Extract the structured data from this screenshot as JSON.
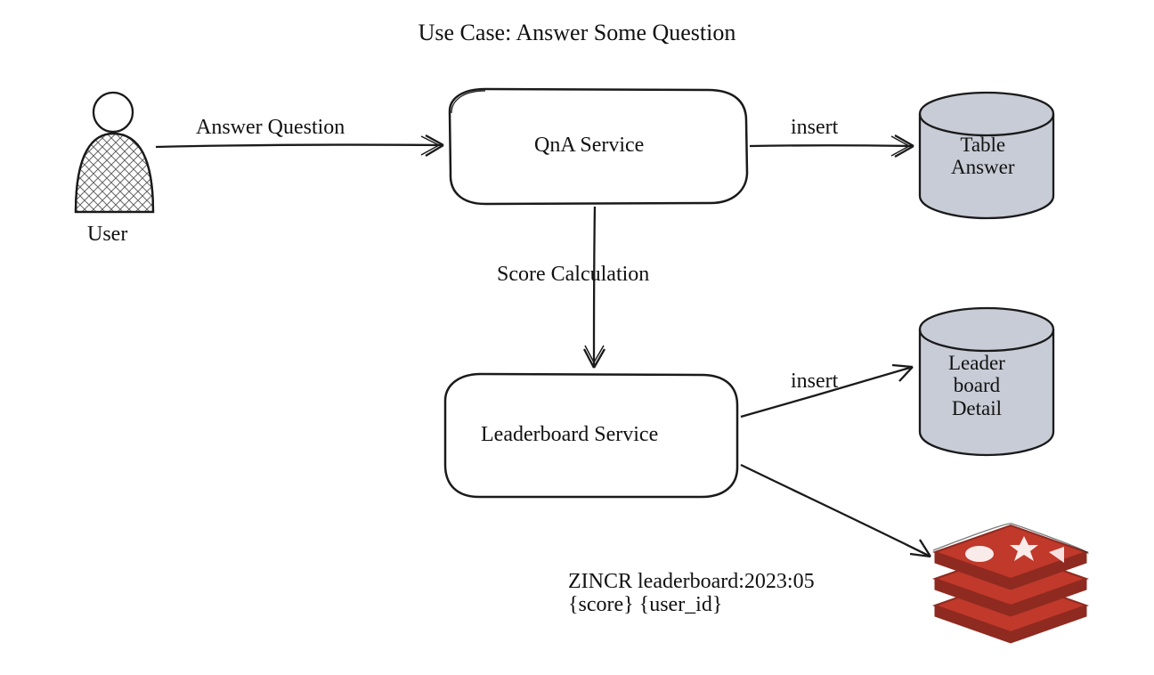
{
  "title": "Use Case: Answer Some Question",
  "actors": {
    "user": "User"
  },
  "nodes": {
    "qna_service": "QnA Service",
    "leaderboard_service": "Leaderboard Service",
    "table_answer": "Table\nAnswer",
    "leaderboard_detail": "Leader\nboard\nDetail"
  },
  "edges": {
    "answer_question": "Answer Question",
    "insert_answer": "insert",
    "score_calculation": "Score Calculation",
    "insert_leaderboard": "insert"
  },
  "redis_command": "ZINCR leaderboard:2023:05\n{score} {user_id}",
  "colors": {
    "stroke": "#1a1a1a",
    "db_fill": "#c7ccd6",
    "redis": "#c0392b",
    "redis_dark": "#8f2a20"
  }
}
